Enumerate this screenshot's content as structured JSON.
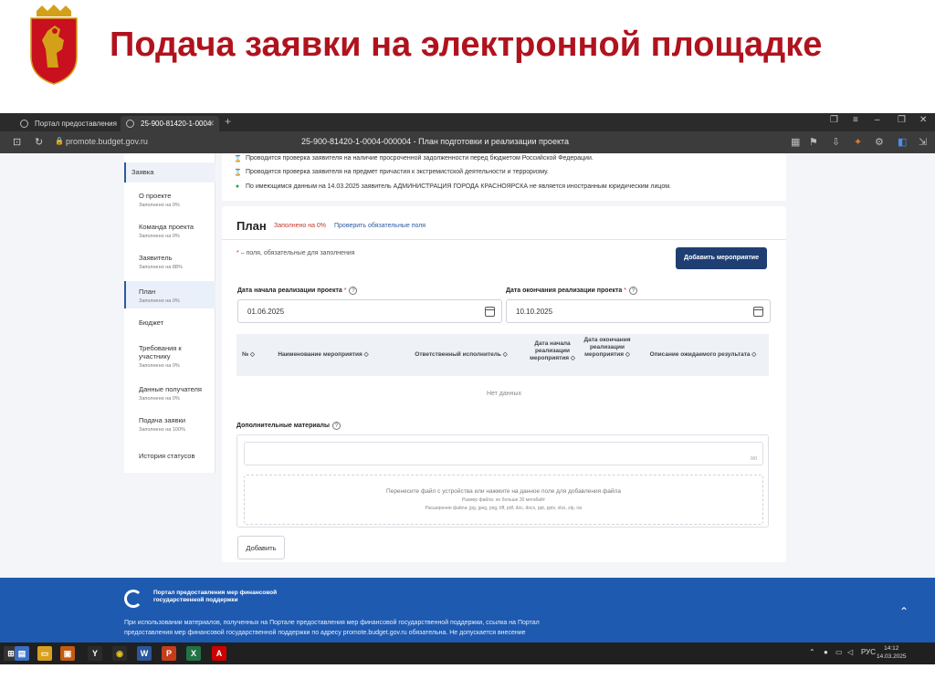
{
  "slide": {
    "title": "Подача заявки на электронной площадке"
  },
  "browser": {
    "tabs": [
      {
        "label": "Портал предоставления"
      },
      {
        "label": "25-900-81420-1-0004"
      }
    ],
    "url": "promote.budget.gov.ru",
    "page_title": "25-900-81420-1-0004-000004 - План подготовки и реализации проекта"
  },
  "sidebar": {
    "top_label": "Заявка",
    "items": [
      {
        "label": "О проекте",
        "sub": "Заполнено на 0%"
      },
      {
        "label": "Команда проекта",
        "sub": "Заполнено на 0%"
      },
      {
        "label": "Заявитель",
        "sub": "Заполнено на 88%"
      },
      {
        "label": "План",
        "sub": "Заполнено на 0%"
      },
      {
        "label": "Бюджет",
        "sub": ""
      },
      {
        "label": "Требования к участнику",
        "sub": "Заполнено на 0%"
      },
      {
        "label": "Данные получателя",
        "sub": "Заполнено на 0%"
      },
      {
        "label": "Подача заявки",
        "sub": "Заполнено на 100%"
      },
      {
        "label": "История статусов",
        "sub": ""
      }
    ]
  },
  "checks": [
    {
      "text": "Проводится проверка заявителя на наличие просроченной задолженности перед бюджетом Российской Федерации."
    },
    {
      "text": "Проводится проверка заявителя на предмет причастия к экстремистской деятельности и терроризму."
    },
    {
      "text": "По имеющимся данным на 14.03.2025 заявитель АДМИНИСТРАЦИЯ ГОРОДА КРАСНОЯРСКА не является иностранным юридическим лицом."
    }
  ],
  "plan": {
    "title": "План",
    "fill_status": "Заполнено на 0%",
    "check_link": "Проверить обязательные поля",
    "required_note": "– поля, обязательные для заполнения",
    "add_event_button": "Добавить мероприятие",
    "start_label": "Дата начала реализации проекта",
    "start_value": "01.06.2025",
    "end_label": "Дата окончания реализации проекта",
    "end_value": "10.10.2025",
    "table_headers": [
      "№",
      "Наименование мероприятия",
      "Ответственный исполнитель",
      "Дата начала реализации мероприятия",
      "Дата окончания реализации мероприятия",
      "Описание ожидаемого результата"
    ],
    "no_data": "Нет данных",
    "materials_label": "Дополнительные материалы",
    "char_count": "0/0",
    "drop_text": "Перенесите файл с устройства или нажмите на данное поле для добавления файла",
    "drop_size": "Размер файла: не больше 30 мегабайт",
    "drop_ext": "Расширения файла: jpg, jpeg, png, tiff, pdf, doc, docx, ppt, pptx, xlsx, zip, rar",
    "add_button": "Добавить"
  },
  "footer": {
    "brand": "Портал предоставления мер финансовой государственной поддержки",
    "text": "При использовании материалов, полученных на Портале предоставления мер финансовой государственной поддержки, ссылка на Портал предоставления мер финансовой государственной поддержки по адресу promote.budget.gov.ru обязательна. Не допускается внесение"
  },
  "taskbar": {
    "lang": "РУС",
    "time": "14:12",
    "date": "14.03.2025"
  },
  "colors": {
    "title": "#b0131e",
    "accent": "#1f3f73",
    "footer": "#1e5ab0"
  }
}
